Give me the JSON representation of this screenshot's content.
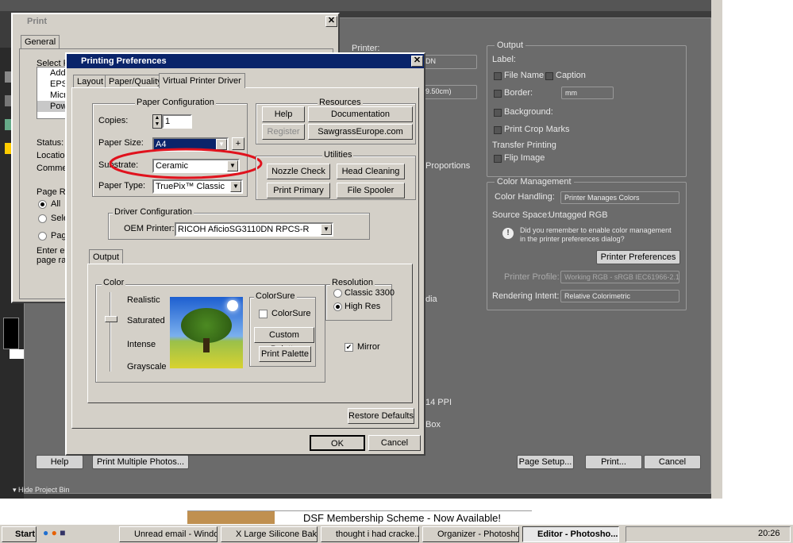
{
  "photoshop": {
    "print": {
      "printer_label": "Printer:",
      "printer_value": "DN",
      "size_value": "9.50cm)",
      "proportions": "Proportions",
      "dia": "dia",
      "ppi": "14 PPI",
      "box": "Box",
      "output": {
        "title": "Output",
        "label": "Label:",
        "file_name": "File Name",
        "caption": "Caption",
        "border": "Border:",
        "border_unit": "mm",
        "background": "Background:",
        "crop_marks": "Print Crop Marks",
        "transfer": "Transfer Printing",
        "flip": "Flip Image"
      },
      "color_mgmt": {
        "title": "Color Management",
        "handling_label": "Color Handling:",
        "handling_value": "Printer Manages Colors",
        "source_label": "Source Space:",
        "source_value": "Untagged RGB",
        "note": "Did you remember to enable color management in the printer preferences dialog?",
        "pref_button": "Printer Preferences",
        "profile_label": "Printer Profile:",
        "profile_value": "Working RGB - sRGB IEC61966-2.1",
        "intent_label": "Rendering Intent:",
        "intent_value": "Relative Colorimetric"
      },
      "help": "Help",
      "print_multiple": "Print Multiple Photos...",
      "page_setup": "Page Setup...",
      "print": "Print...",
      "cancel": "Cancel"
    },
    "hide_bin": "Hide Project Bin"
  },
  "print_dialog": {
    "title": "Print",
    "tab": "General",
    "select_printer": "Select Pr",
    "printers": [
      "Add",
      "EPS",
      "Micr",
      "Pow"
    ],
    "status": "Status:",
    "location": "Location",
    "comment": "Commen",
    "page_range": "Page Ra",
    "all": "All",
    "selection": "Selec",
    "pages": "Page",
    "enter": "Enter eith",
    "page_ran": "page ran"
  },
  "prefs": {
    "title": "Printing Preferences",
    "tabs": [
      "Layout",
      "Paper/Quality",
      "Virtual Printer Driver"
    ],
    "paper_config": "Paper Configuration",
    "copies_label": "Copies:",
    "copies_value": "1",
    "paper_size_label": "Paper Size:",
    "paper_size_value": "A4",
    "plus": "+",
    "substrate_label": "Substrate:",
    "substrate_value": "Ceramic",
    "paper_type_label": "Paper Type:",
    "paper_type_value": "TruePix™ Classic",
    "resources": "Resources",
    "help": "Help",
    "documentation": "Documentation",
    "register": "Register",
    "sawgrass": "SawgrassEurope.com",
    "utilities": "Utilities",
    "nozzle": "Nozzle Check",
    "head": "Head Cleaning",
    "print_primary": "Print Primary",
    "file_spooler": "File Spooler",
    "driver_config": "Driver Configuration",
    "oem_label": "OEM Printer:",
    "oem_value": "RICOH AficioSG3110DN RPCS-R",
    "output_tab": "Output",
    "color": "Color",
    "levels": [
      "Realistic",
      "Saturated",
      "Intense",
      "Grayscale"
    ],
    "colorsure_group": "ColorSure",
    "colorsure": "ColorSure",
    "custom_palette": "Custom Palette",
    "print_palette": "Print Palette",
    "resolution": "Resolution",
    "classic": "Classic 3300",
    "high_res": "High Res",
    "mirror": "Mirror",
    "check": "✔",
    "restore": "Restore Defaults",
    "ok": "OK",
    "cancel": "Cancel"
  },
  "banner": "DSF Membership Scheme - Now Available!",
  "taskbar": {
    "start": "Start",
    "tasks": [
      "Unread email - Windo...",
      "X Large Silicone Baki...",
      "thought i had cracke...",
      "Organizer - Photosho...",
      "Editor - Photosho..."
    ],
    "clock": "20:26"
  },
  "icons": {
    "close": "✕",
    "arrow": "▼"
  }
}
